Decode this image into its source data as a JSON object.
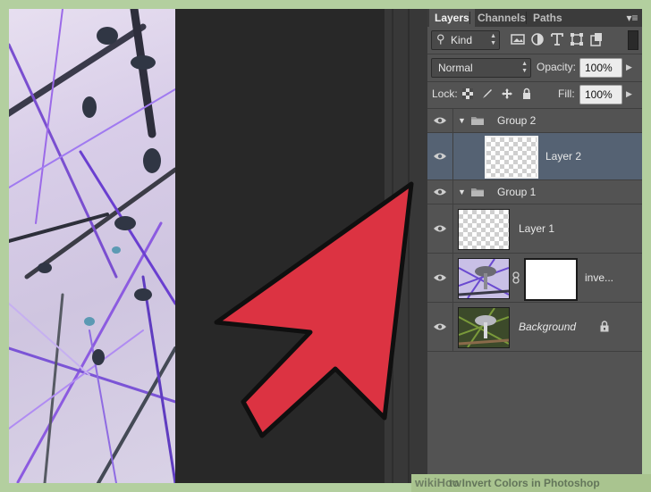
{
  "tabs": {
    "layers": "Layers",
    "channels": "Channels",
    "paths": "Paths"
  },
  "filter": {
    "kind_label": "Kind",
    "icons": [
      "image-filter-icon",
      "adjustment-filter-icon",
      "type-filter-icon",
      "shape-filter-icon",
      "smart-object-filter-icon"
    ]
  },
  "blending": {
    "mode": "Normal",
    "opacity_label": "Opacity:",
    "opacity_value": "100%"
  },
  "lock": {
    "label": "Lock:",
    "fill_label": "Fill:",
    "fill_value": "100%"
  },
  "layers": [
    {
      "type": "group",
      "name": "Group 2"
    },
    {
      "type": "layer",
      "name": "Layer 2",
      "selected": true
    },
    {
      "type": "group",
      "name": "Group 1"
    },
    {
      "type": "layer",
      "name": "Layer 1"
    },
    {
      "type": "adjustment",
      "name": "inve..."
    },
    {
      "type": "background",
      "name": "Background",
      "locked": true
    }
  ],
  "watermark": {
    "logo": "wiki",
    "logo_bold": "How",
    "title": "to Invert Colors in Photoshop"
  },
  "colors": {
    "panel_bg": "#535353",
    "selected_row": "#556273",
    "arrow_red": "#dc3342",
    "frame_green": "#b3cf9f"
  }
}
